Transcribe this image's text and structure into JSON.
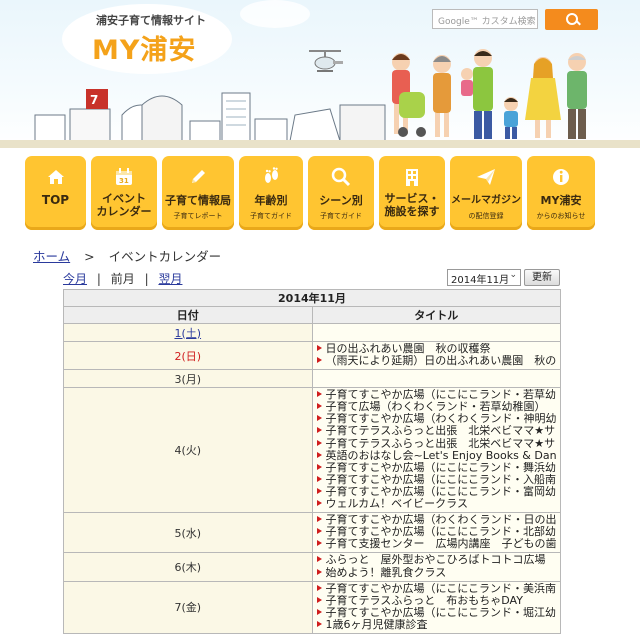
{
  "header": {
    "site_subtitle": "浦安子育て情報サイト",
    "site_title": "MY浦安",
    "search_placeholder": "Google™ カスタム検索",
    "search_icon": "search-icon",
    "accent_color": "#f48b1d"
  },
  "nav": [
    {
      "label": "TOP",
      "sub": "",
      "icon": "home-icon"
    },
    {
      "label": "イベント\nカレンダー",
      "sub": "",
      "icon": "calendar-icon"
    },
    {
      "label": "子育て情報局",
      "sub": "子育てレポート",
      "icon": "pencil-icon"
    },
    {
      "label": "年齢別",
      "sub": "子育てガイド",
      "icon": "footprints-icon"
    },
    {
      "label": "シーン別",
      "sub": "子育てガイド",
      "icon": "magnifier-icon"
    },
    {
      "label": "サービス・\n施設を探す",
      "sub": "",
      "icon": "building-icon"
    },
    {
      "label": "メールマガジン",
      "sub": "の配信登録",
      "icon": "paper-plane-icon"
    },
    {
      "label": "MY浦安",
      "sub": "からのお知らせ",
      "icon": "info-icon"
    }
  ],
  "breadcrumb": {
    "home": "ホーム",
    "separator": ">",
    "current": "イベントカレンダー"
  },
  "month_nav": {
    "this_month": "今月",
    "prev_month": "前月",
    "next_month": "翌月",
    "divider": "|"
  },
  "month_select": {
    "value": "2014年11月"
  },
  "update_button": "更新",
  "calendar": {
    "caption": "2014年11月",
    "col_date": "日付",
    "col_title": "タイトル",
    "rows": [
      {
        "date": "1(土)",
        "style": "link",
        "events": []
      },
      {
        "date": "2(日)",
        "style": "sun",
        "events": [
          "日の出ふれあい農園　秋の収穫祭",
          "（雨天により延期）日の出ふれあい農園　秋の収穫祭"
        ]
      },
      {
        "date": "3(月)",
        "style": "plain",
        "events": []
      },
      {
        "date": "4(火)",
        "style": "plain",
        "events": [
          "子育てすこやか広場（にこにこランド・若草幼稚園）",
          "子育て広場（わくわくランド・若草幼稚園）",
          "子育てすこやか広場（わくわくランド・神明幼稚園）",
          "子育てテラスふらっと出張　北栄ベビママ★サロン　マタニティヨガ",
          "子育てテラスふらっと出張　北栄ベビママ★サロン　KU・RU・RI",
          "英語のおはなし会~Let's Enjoy Books & Dancing",
          "子育てすこやか広場（にこにこランド・舞浜幼稚園）",
          "子育てすこやか広場（にこにこランド・入船南幼稚園）",
          "子育てすこやか広場（にこにこランド・富岡幼稚園）",
          "ウェルカム！ベイビークラス"
        ]
      },
      {
        "date": "5(水)",
        "style": "plain",
        "events": [
          "子育てすこやか広場（わくわくランド・日の出幼稚園）",
          "子育てすこやか広場（にこにこランド・北部幼稚園）",
          "子育て支援センター　広場内講座　子どもの歯について"
        ]
      },
      {
        "date": "6(木)",
        "style": "plain",
        "events": [
          "ふらっと　屋外型おやこひろばトコトコ広場",
          "始めよう！離乳食クラス"
        ]
      },
      {
        "date": "7(金)",
        "style": "plain",
        "events": [
          "子育てすこやか広場（にこにこランド・美浜南幼稚園）",
          "子育てテラスふらっと　布おもちゃDAY",
          "子育てすこやか広場（にこにこランド・堀江幼稚園）",
          "1歳6ヶ月児健康診査"
        ]
      }
    ]
  }
}
